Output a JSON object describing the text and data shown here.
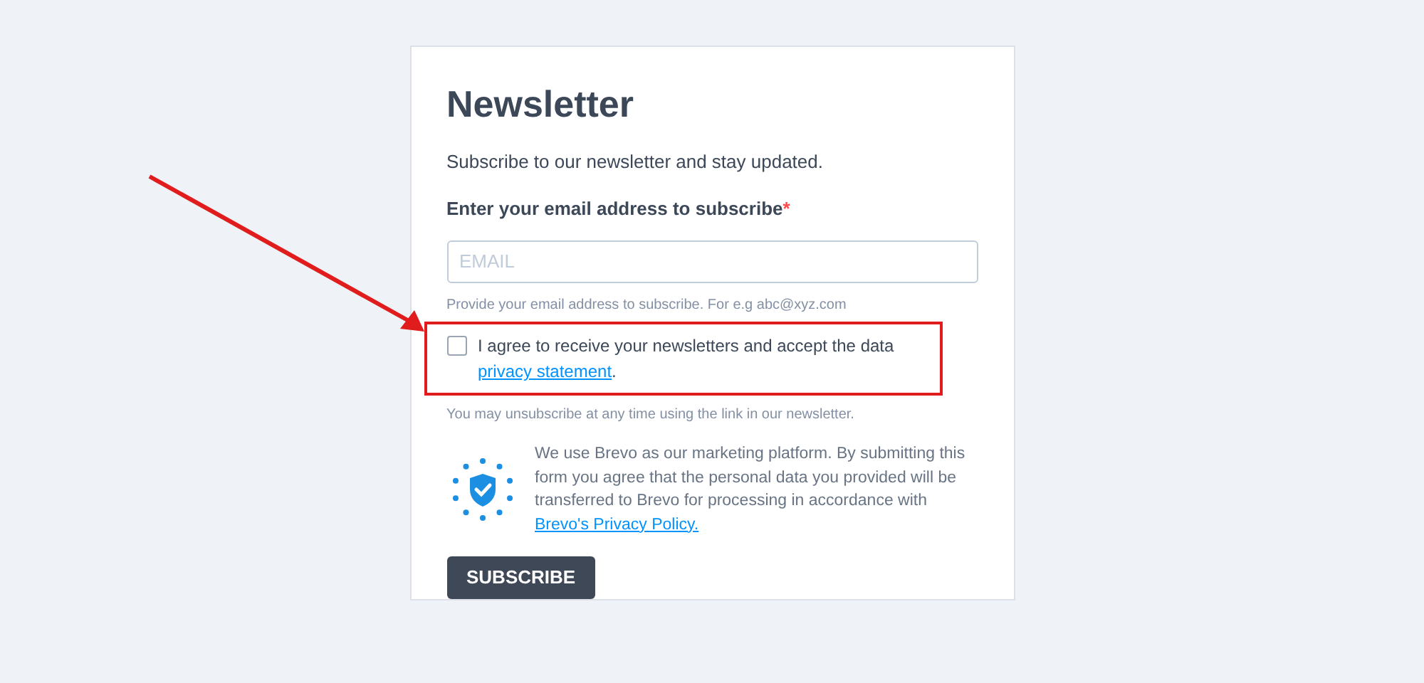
{
  "form": {
    "title": "Newsletter",
    "intro": "Subscribe to our newsletter and stay updated.",
    "email_label": "Enter your email address to subscribe",
    "required_mark": "*",
    "email_field": {
      "placeholder": "EMAIL"
    },
    "email_hint": "Provide your email address to subscribe. For e.g abc@xyz.com",
    "consent": {
      "checked": false,
      "highlighted": true,
      "text": "I agree to receive your newsletters and accept the data",
      "link": "privacy statement",
      "after": "."
    },
    "unsubscribe_note": "You may unsubscribe at any time using the link in our newsletter.",
    "platform_note": {
      "text": "We use Brevo as our marketing platform. By submitting this form you agree that the personal data you provided will be transferred to Brevo for processing in accordance with",
      "link": "Brevo's Privacy Policy."
    },
    "submit_button": "SUBSCRIBE"
  },
  "annotation": {
    "arrow": true
  }
}
